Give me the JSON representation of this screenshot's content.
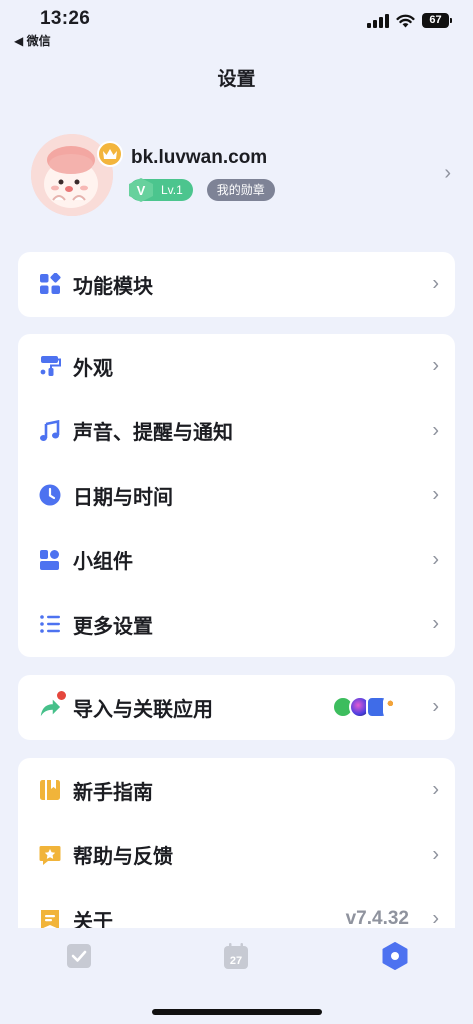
{
  "status_bar": {
    "time": "13:26",
    "back_app": "◀ 微信",
    "battery": "67"
  },
  "page_title": "设置",
  "profile": {
    "username": "bk.luvwan.com",
    "level": "Lv.1",
    "level_mark": "V",
    "medal": "我的勋章"
  },
  "sections": {
    "modules": {
      "label": "功能模块"
    },
    "appearance": {
      "label": "外观"
    },
    "sound": {
      "label": "声音、提醒与通知"
    },
    "datetime": {
      "label": "日期与时间"
    },
    "widgets": {
      "label": "小组件"
    },
    "more": {
      "label": "更多设置"
    },
    "import": {
      "label": "导入与关联应用"
    },
    "guide": {
      "label": "新手指南"
    },
    "help": {
      "label": "帮助与反馈"
    },
    "about": {
      "label": "关于",
      "version": "v7.4.32"
    }
  },
  "tabbar": {
    "calendar_day": "27"
  },
  "colors": {
    "accent": "#4d72f0",
    "background": "#eef1fb",
    "green": "#4cc58e",
    "gold": "#f3b53c"
  }
}
